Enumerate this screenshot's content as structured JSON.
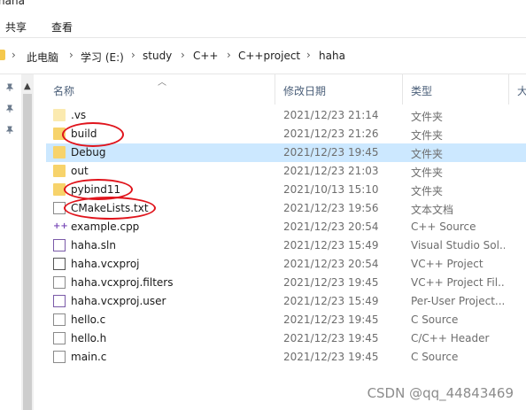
{
  "window": {
    "title": "haha"
  },
  "ribbon": {
    "tabs": [
      "共享",
      "查看"
    ]
  },
  "address": {
    "crumbs": [
      "此电脑",
      "学习 (E:)",
      "study",
      "C++",
      "C++project",
      "haha"
    ]
  },
  "columns": {
    "name": "名称",
    "date": "修改日期",
    "type": "类型",
    "size": "大"
  },
  "files": [
    {
      "name": ".vs",
      "date": "2021/12/23 21:14",
      "type": "文件夹",
      "icon": "folder-light-icon"
    },
    {
      "name": "build",
      "date": "2021/12/23 21:26",
      "type": "文件夹",
      "icon": "folder-icon",
      "circled": true
    },
    {
      "name": "Debug",
      "date": "2021/12/23 19:45",
      "type": "文件夹",
      "icon": "folder-icon",
      "selected": true
    },
    {
      "name": "out",
      "date": "2021/12/23 21:03",
      "type": "文件夹",
      "icon": "folder-icon"
    },
    {
      "name": "pybind11",
      "date": "2021/10/13 15:10",
      "type": "文件夹",
      "icon": "folder-icon",
      "circled": true
    },
    {
      "name": "CMakeLists.txt",
      "date": "2021/12/23 19:56",
      "type": "文本文档",
      "icon": "text-document-icon",
      "circled": true
    },
    {
      "name": "example.cpp",
      "date": "2021/12/23 20:54",
      "type": "C++ Source",
      "icon": "cpp-file-icon"
    },
    {
      "name": "haha.sln",
      "date": "2021/12/23 15:49",
      "type": "Visual Studio Sol...",
      "icon": "solution-file-icon"
    },
    {
      "name": "haha.vcxproj",
      "date": "2021/12/23 20:54",
      "type": "VC++ Project",
      "icon": "vcxproj-file-icon"
    },
    {
      "name": "haha.vcxproj.filters",
      "date": "2021/12/23 19:45",
      "type": "VC++ Project Fil...",
      "icon": "filters-file-icon"
    },
    {
      "name": "haha.vcxproj.user",
      "date": "2021/12/23 15:49",
      "type": "Per-User Project...",
      "icon": "user-file-icon"
    },
    {
      "name": "hello.c",
      "date": "2021/12/23 19:45",
      "type": "C Source",
      "icon": "c-file-icon"
    },
    {
      "name": "hello.h",
      "date": "2021/12/23 19:45",
      "type": "C/C++ Header",
      "icon": "h-file-icon"
    },
    {
      "name": "main.c",
      "date": "2021/12/23 19:45",
      "type": "C Source",
      "icon": "c-file-icon"
    }
  ],
  "watermark": "CSDN @qq_44843469",
  "colors": {
    "selection": "#cce8ff",
    "annotation": "#e0141c",
    "folder": "#f7d36b"
  }
}
